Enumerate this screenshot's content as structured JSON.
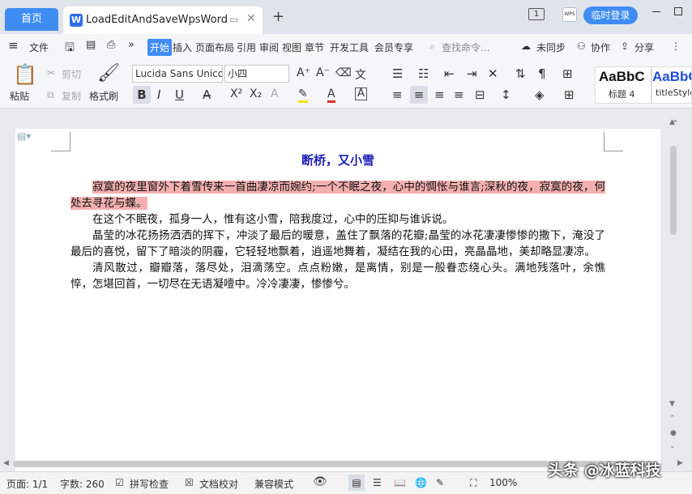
{
  "tabs": {
    "home_label": "首页",
    "doc_title": "LoadEditAndSaveWpsWord",
    "doc_icon": "W",
    "new_tab_glyph": "+"
  },
  "titlebar": {
    "page_count_badge": "1",
    "avatar_text": "WPS",
    "login_label": "临时登录"
  },
  "menu": {
    "file_label": "文件",
    "items": [
      "开始",
      "插入",
      "页面布局",
      "引用",
      "审阅",
      "视图",
      "章节",
      "开发工具",
      "会员专享"
    ],
    "search_placeholder": "查找命令...",
    "sync_label": "未同步",
    "collab_label": "协作",
    "share_label": "分享"
  },
  "ribbon": {
    "paste_label": "粘贴",
    "cut_label": "剪切",
    "copy_label": "复制",
    "format_painter_label": "格式刷",
    "font_name": "Lucida Sans Unico",
    "font_size": "小四",
    "style_preview": "AaBbC",
    "style1_name": "标题 4",
    "style2_name": "titleStyle"
  },
  "document": {
    "title": "断桥，又小雪",
    "paragraphs": [
      "寂寞的夜里窗外下着雪传来一首曲凄凉而婉约;一个不眠之夜，心中的惆怅与谁言;深秋的夜，寂寞的夜，何处去寻花与蝶。",
      "在这个不眠夜，孤身一人，惟有这小雪，陪我度过，心中的压抑与谁诉说。",
      "晶莹的冰花扬扬洒洒的挥下，冲淡了最后的暖意，盖住了飘落的花瓣;晶莹的冰花凄凄惨惨的撒下，淹没了最后的喜悦，留下了暗淡的阴霾，它轻轻地飘着，逍遥地舞着，凝结在我的心田，亮晶晶地，美却略显凄凉。",
      "清风散过，瓣瓣落，落尽处，泪滴荡空。点点粉嫩，是离情，别是一般眷恋绕心头。满地残落叶，余憔悴，怎堪回首，一切尽在无语凝噎中。冷冷凄凄，惨惨兮。"
    ]
  },
  "status": {
    "page": "页面: 1/1",
    "words": "字数: 260",
    "spellcheck": "拼写检查",
    "doc_proof": "文档校对",
    "compat_mode": "兼容模式",
    "zoom": "100%"
  },
  "watermark": "头条 @冰蓝科技",
  "colors": {
    "accent": "#3f8cf3",
    "title_blue": "#1e20b8",
    "highlight": "#f4b0b0"
  }
}
